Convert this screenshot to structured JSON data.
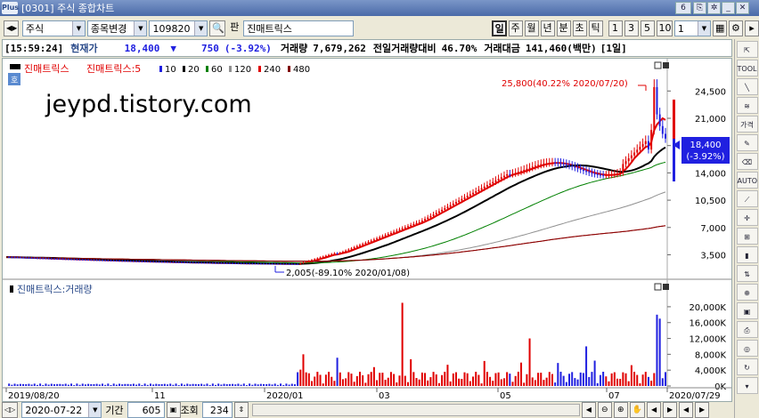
{
  "window": {
    "app_logo": "Plus",
    "title": "[0301] 주식 종합차트",
    "tab_num": "6"
  },
  "toolbar": {
    "market": "주식",
    "mode": "종목변경",
    "code": "109820",
    "stock_btn": "판",
    "stock_name": "진매트릭스",
    "periods": [
      "일",
      "주",
      "월",
      "년",
      "분",
      "초",
      "틱"
    ],
    "active_period": "일",
    "numbers": [
      "1",
      "3",
      "5",
      "10"
    ],
    "interval": "1"
  },
  "info": {
    "time": "[15:59:24]",
    "price_label": "현재가",
    "price": "18,400",
    "change_icon": "down-triangle",
    "change": "750",
    "change_pct": "(-3.92%)",
    "volume_label": "거래량",
    "volume": "7,679,262",
    "prev_vol_label": "전일거래량대비",
    "prev_vol": "46.70%",
    "amount_label": "거래대금",
    "amount": "141,460(백만)",
    "period": "[1일]"
  },
  "price_legend": {
    "name": "진매트릭스",
    "ma_title": "진매트릭스:5",
    "ma": [
      "5",
      "10",
      "20",
      "60",
      "120",
      "240",
      "480"
    ],
    "ma_colors": [
      "#e00000",
      "#2020e0",
      "#000000",
      "#008000",
      "#909090",
      "#e00000",
      "#800000"
    ]
  },
  "watermark": "jeypd.tistory.com",
  "price_axis": [
    "24,500",
    "21,000",
    "17,500",
    "14,000",
    "10,500",
    "7,000",
    "3,500"
  ],
  "current_price_box": {
    "price": "18,400",
    "pct": "(-3.92%)"
  },
  "annotations": {
    "high": "25,800(40.22% 2020/07/20)",
    "low": "2,005(-89.10% 2020/01/08)"
  },
  "volume_pane": {
    "title": "진매트릭스:거래량",
    "axis": [
      "20,000K",
      "16,000K",
      "12,000K",
      "8,000K",
      "4,000K",
      "0K"
    ]
  },
  "date_axis": [
    "2019/08/20",
    "11",
    "2020/01",
    "03",
    "05",
    "07",
    "2020/07/29"
  ],
  "bottom": {
    "date": "2020-07-22",
    "period_label": "기간",
    "period": "605",
    "view_label": "조회",
    "view": "234"
  },
  "colors": {
    "up": "#e00000",
    "down": "#2020e0",
    "accent": "#2a4a8a"
  }
}
